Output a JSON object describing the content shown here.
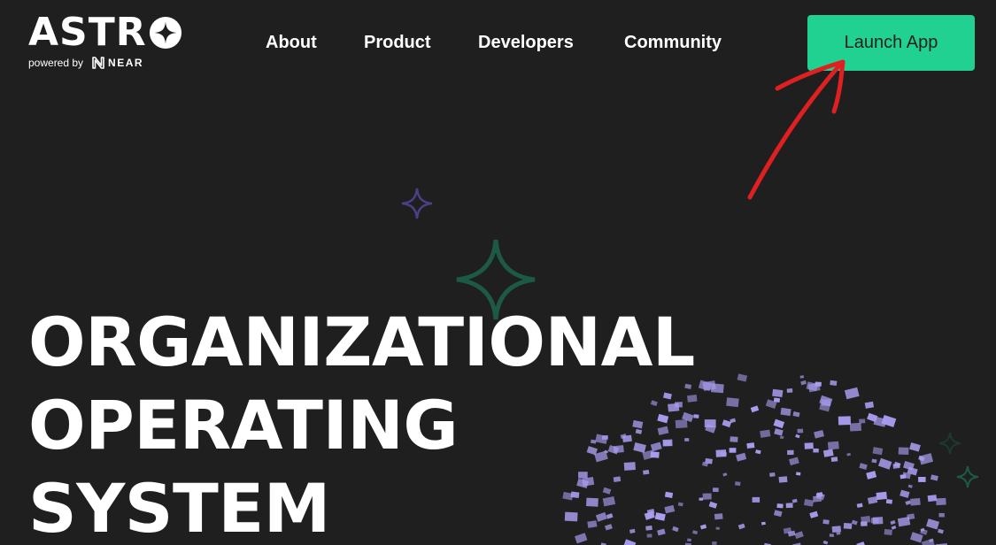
{
  "brand": {
    "name": "ASTR",
    "powered_by": "powered by",
    "partner": "NEAR"
  },
  "nav": {
    "items": [
      {
        "label": "About"
      },
      {
        "label": "Product"
      },
      {
        "label": "Developers"
      },
      {
        "label": "Community"
      }
    ],
    "cta_label": "Launch App"
  },
  "hero": {
    "lines": [
      "ORGANIZATIONAL",
      "OPERATING",
      "SYSTEM"
    ]
  },
  "colors": {
    "background": "#1f1f20",
    "accent": "#21d192",
    "sparkle_purple": "#4b3f86",
    "sparkle_green": "#1c5a46",
    "globe_dots": "#a99ef0",
    "annotation_arrow": "#e02020"
  },
  "icons": {
    "logo_o": "sparkle-o-icon",
    "near": "near-logo-icon",
    "sparkles": "sparkle-icon",
    "arrow": "red-arrow-icon"
  }
}
